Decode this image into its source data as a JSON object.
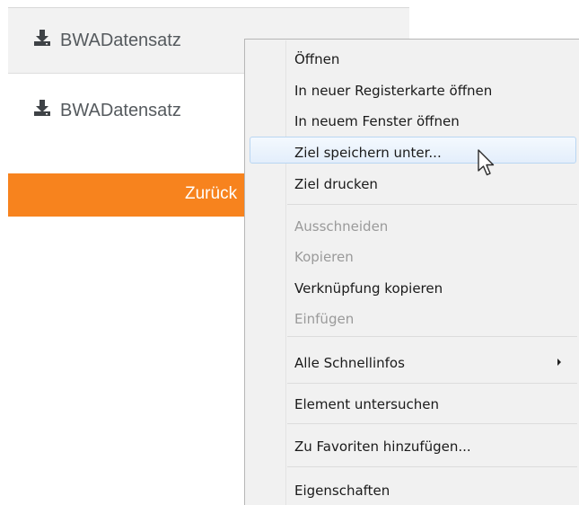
{
  "page": {
    "downloads": [
      {
        "label": "BWADatensatz",
        "icon": "download-icon"
      },
      {
        "label": "BWADatensatz",
        "icon": "download-icon"
      }
    ],
    "back_button": {
      "label": "Zurück",
      "color": "#f7831e"
    }
  },
  "context_menu": {
    "groups": [
      [
        {
          "label": "Öffnen",
          "enabled": true
        },
        {
          "label": "In neuer Registerkarte öffnen",
          "enabled": true
        },
        {
          "label": "In neuem Fenster öffnen",
          "enabled": true
        },
        {
          "label": "Ziel speichern unter...",
          "enabled": true,
          "highlighted": true
        },
        {
          "label": "Ziel drucken",
          "enabled": true
        }
      ],
      [
        {
          "label": "Ausschneiden",
          "enabled": false
        },
        {
          "label": "Kopieren",
          "enabled": false
        },
        {
          "label": "Verknüpfung kopieren",
          "enabled": true
        },
        {
          "label": "Einfügen",
          "enabled": false
        }
      ],
      [
        {
          "label": "Alle Schnellinfos",
          "enabled": true,
          "submenu": true,
          "icon": "submenu-arrow-icon"
        }
      ],
      [
        {
          "label": "Element untersuchen",
          "enabled": true
        }
      ],
      [
        {
          "label": "Zu Favoriten hinzufügen...",
          "enabled": true
        }
      ],
      [
        {
          "label": "Eigenschaften",
          "enabled": true
        }
      ]
    ],
    "highlight_color": "#b9d6f2"
  },
  "cursor": {
    "icon": "mouse-pointer-icon"
  }
}
